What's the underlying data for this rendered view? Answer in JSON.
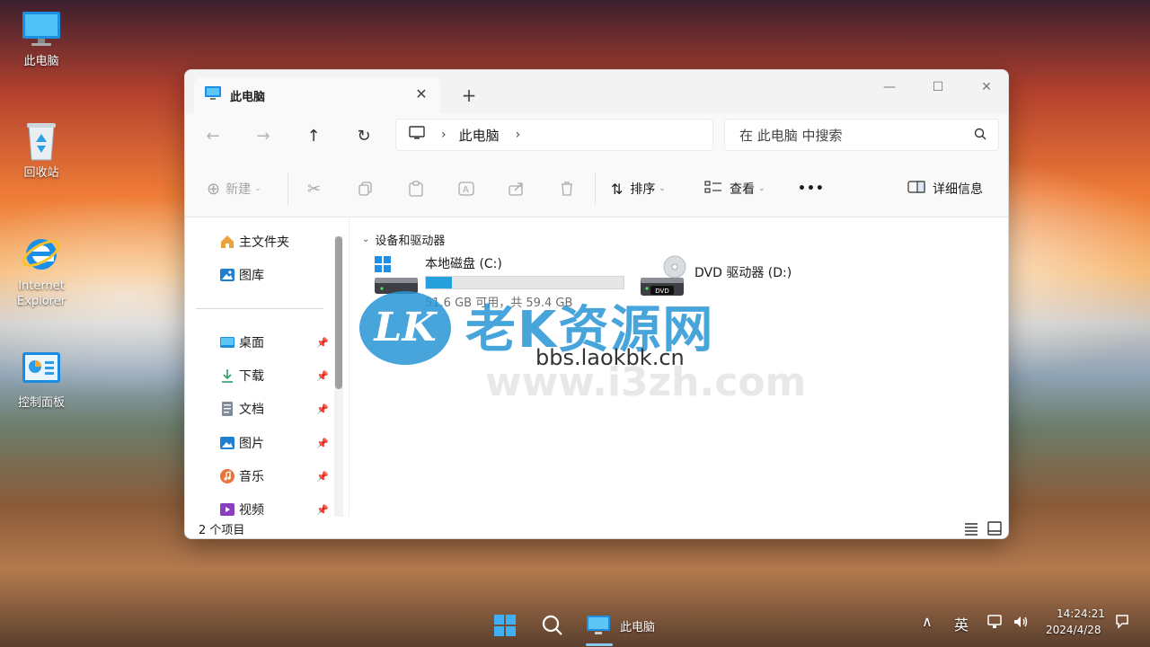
{
  "desktop": {
    "icons": [
      {
        "label": "此电脑"
      },
      {
        "label": "回收站"
      },
      {
        "label": "Internet Explorer"
      },
      {
        "label": "控制面板"
      }
    ]
  },
  "window": {
    "tab_title": "此电脑",
    "close_tab": "✕",
    "new_tab": "+",
    "minimize": "—",
    "maximize": "☐",
    "close": "✕",
    "breadcrumb": "此电脑",
    "search_placeholder": "在 此电脑 中搜索"
  },
  "command_bar": {
    "new_label": "新建",
    "sort_label": "排序",
    "view_label": "查看",
    "more_label": "•••",
    "details_label": "详细信息"
  },
  "sidebar": {
    "items": [
      {
        "label": "主文件夹"
      },
      {
        "label": "图库"
      },
      {
        "label": "桌面"
      },
      {
        "label": "下载"
      },
      {
        "label": "文档"
      },
      {
        "label": "图片"
      },
      {
        "label": "音乐"
      },
      {
        "label": "视频"
      }
    ]
  },
  "content": {
    "group_label": "设备和驱动器",
    "drives": [
      {
        "name": "本地磁盘 (C:)",
        "size_text": "51.6 GB 可用，共 59.4 GB",
        "used_fraction": 0.13
      },
      {
        "name": "DVD 驱动器 (D:)",
        "badge": "DVD"
      }
    ]
  },
  "status": {
    "item_count": "2 个项目"
  },
  "watermark": {
    "logo": "LK",
    "title": "老K资源网",
    "url": "bbs.laokbk.cn",
    "faint": "www.i3zh.com"
  },
  "taskbar": {
    "app_label": "此电脑",
    "ime": "英",
    "time": "14:24:21",
    "date": "2024/4/28"
  },
  "colors": {
    "accent": "#26a0da",
    "folder": "#e8a33a"
  }
}
